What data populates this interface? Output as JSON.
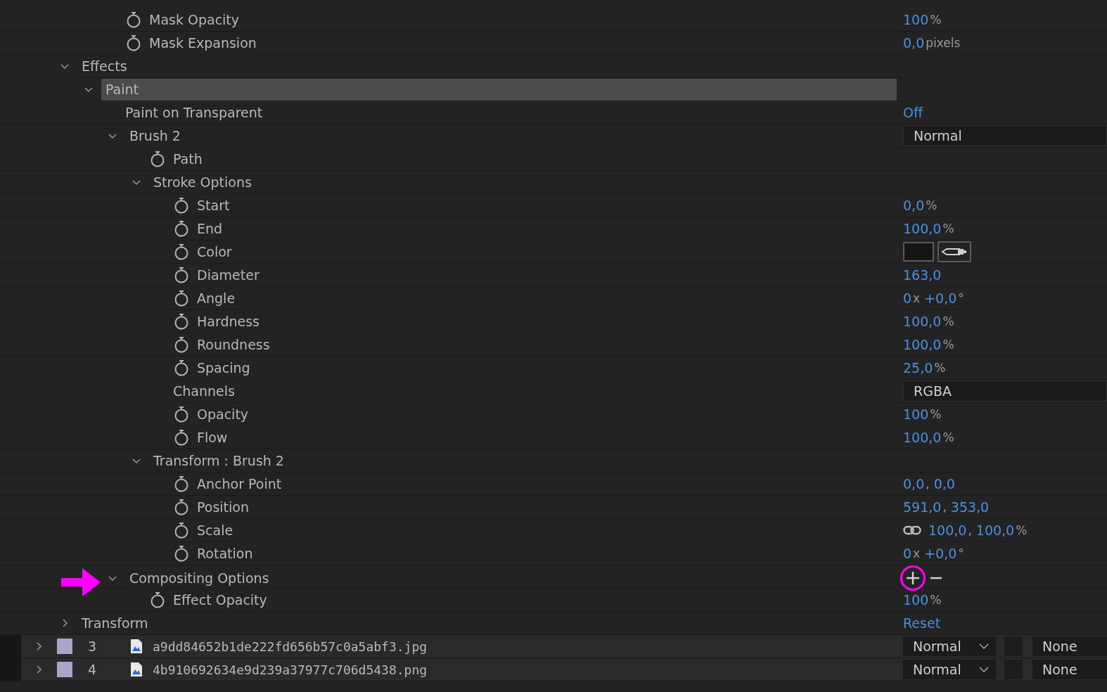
{
  "mask_properties": [
    {
      "label": "Mask Opacity",
      "kind": "property",
      "selected": false,
      "value": {
        "kind": "number",
        "parts": [
          {
            "text": "100",
            "kind": "num"
          },
          {
            "text": "%",
            "kind": "unit"
          }
        ]
      }
    },
    {
      "label": "Mask Expansion",
      "kind": "property",
      "selected": false,
      "value": {
        "kind": "number",
        "parts": [
          {
            "text": "0,0",
            "kind": "num"
          },
          {
            "text": "pixels",
            "kind": "unit"
          }
        ]
      }
    }
  ],
  "effects": [
    {
      "label": "Effects",
      "kind": "group",
      "expanded": true,
      "selected": false,
      "children": [
        {
          "label": "Paint",
          "kind": "group",
          "expanded": true,
          "selected": true,
          "children": [
            {
              "label": "Paint on Transparent",
              "kind": "plain",
              "selected": false,
              "value": {
                "kind": "number",
                "parts": [
                  {
                    "text": "Off",
                    "kind": "num"
                  }
                ]
              }
            },
            {
              "label": "Brush 2",
              "kind": "group",
              "expanded": true,
              "selected": false,
              "value": {
                "kind": "dropdown",
                "text": "Normal"
              },
              "children": [
                {
                  "label": "Path",
                  "kind": "property",
                  "selected": false
                },
                {
                  "label": "Stroke Options",
                  "kind": "group",
                  "expanded": true,
                  "selected": false,
                  "children": [
                    {
                      "label": "Start",
                      "kind": "property",
                      "selected": false,
                      "value": {
                        "kind": "number",
                        "parts": [
                          {
                            "text": "0,0",
                            "kind": "num"
                          },
                          {
                            "text": "%",
                            "kind": "unit"
                          }
                        ]
                      }
                    },
                    {
                      "label": "End",
                      "kind": "property",
                      "selected": false,
                      "value": {
                        "kind": "number",
                        "parts": [
                          {
                            "text": "100,0",
                            "kind": "num"
                          },
                          {
                            "text": "%",
                            "kind": "unit"
                          }
                        ]
                      }
                    },
                    {
                      "label": "Color",
                      "kind": "property",
                      "selected": false,
                      "value": {
                        "kind": "color",
                        "color": "#151515"
                      }
                    },
                    {
                      "label": "Diameter",
                      "kind": "property",
                      "selected": false,
                      "value": {
                        "kind": "number",
                        "parts": [
                          {
                            "text": "163,0",
                            "kind": "num"
                          }
                        ]
                      }
                    },
                    {
                      "label": "Angle",
                      "kind": "property",
                      "selected": false,
                      "value": {
                        "kind": "number",
                        "parts": [
                          {
                            "text": "0",
                            "kind": "num"
                          },
                          {
                            "text": "x",
                            "kind": "unit"
                          },
                          {
                            "text": "+0,0",
                            "kind": "num"
                          },
                          {
                            "text": "°",
                            "kind": "unit"
                          }
                        ]
                      }
                    },
                    {
                      "label": "Hardness",
                      "kind": "property",
                      "selected": false,
                      "value": {
                        "kind": "number",
                        "parts": [
                          {
                            "text": "100,0",
                            "kind": "num"
                          },
                          {
                            "text": "%",
                            "kind": "unit"
                          }
                        ]
                      }
                    },
                    {
                      "label": "Roundness",
                      "kind": "property",
                      "selected": false,
                      "value": {
                        "kind": "number",
                        "parts": [
                          {
                            "text": "100,0",
                            "kind": "num"
                          },
                          {
                            "text": "%",
                            "kind": "unit"
                          }
                        ]
                      }
                    },
                    {
                      "label": "Spacing",
                      "kind": "property",
                      "selected": false,
                      "value": {
                        "kind": "number",
                        "parts": [
                          {
                            "text": "25,0",
                            "kind": "num"
                          },
                          {
                            "text": "%",
                            "kind": "unit"
                          }
                        ]
                      }
                    },
                    {
                      "label": "Channels",
                      "kind": "plain",
                      "selected": false,
                      "value": {
                        "kind": "dropdown",
                        "text": "RGBA"
                      }
                    },
                    {
                      "label": "Opacity",
                      "kind": "property",
                      "selected": false,
                      "value": {
                        "kind": "number",
                        "parts": [
                          {
                            "text": "100",
                            "kind": "num"
                          },
                          {
                            "text": "%",
                            "kind": "unit"
                          }
                        ]
                      }
                    },
                    {
                      "label": "Flow",
                      "kind": "property",
                      "selected": false,
                      "value": {
                        "kind": "number",
                        "parts": [
                          {
                            "text": "100,0",
                            "kind": "num"
                          },
                          {
                            "text": "%",
                            "kind": "unit"
                          }
                        ]
                      }
                    }
                  ]
                },
                {
                  "label": "Transform : Brush 2",
                  "kind": "group",
                  "expanded": true,
                  "selected": false,
                  "children": [
                    {
                      "label": "Anchor Point",
                      "kind": "property",
                      "selected": false,
                      "value": {
                        "kind": "number",
                        "parts": [
                          {
                            "text": "0,0",
                            "kind": "num"
                          },
                          {
                            "text": ",",
                            "kind": "unit"
                          },
                          {
                            "text": "0,0",
                            "kind": "num"
                          }
                        ]
                      }
                    },
                    {
                      "label": "Position",
                      "kind": "property",
                      "selected": false,
                      "value": {
                        "kind": "number",
                        "parts": [
                          {
                            "text": "591,0",
                            "kind": "num"
                          },
                          {
                            "text": ",",
                            "kind": "unit"
                          },
                          {
                            "text": "353,0",
                            "kind": "num"
                          }
                        ]
                      }
                    },
                    {
                      "label": "Scale",
                      "kind": "property",
                      "selected": false,
                      "value": {
                        "kind": "scale",
                        "parts": [
                          {
                            "text": "100,0",
                            "kind": "num"
                          },
                          {
                            "text": ",",
                            "kind": "unit"
                          },
                          {
                            "text": "100,0",
                            "kind": "num"
                          },
                          {
                            "text": "%",
                            "kind": "unit"
                          }
                        ]
                      }
                    },
                    {
                      "label": "Rotation",
                      "kind": "property",
                      "selected": false,
                      "value": {
                        "kind": "number",
                        "parts": [
                          {
                            "text": "0",
                            "kind": "num"
                          },
                          {
                            "text": "x",
                            "kind": "unit"
                          },
                          {
                            "text": "+0,0",
                            "kind": "num"
                          },
                          {
                            "text": "°",
                            "kind": "unit"
                          }
                        ]
                      }
                    }
                  ]
                }
              ]
            },
            {
              "label": "Compositing Options",
              "kind": "group",
              "expanded": true,
              "selected": false,
              "highlighted": true,
              "value": {
                "kind": "plus_minus",
                "circled": true
              },
              "children": [
                {
                  "label": "Effect Opacity",
                  "kind": "property",
                  "selected": false,
                  "value": {
                    "kind": "number",
                    "parts": [
                      {
                        "text": "100",
                        "kind": "num"
                      },
                      {
                        "text": "%",
                        "kind": "unit"
                      }
                    ]
                  }
                }
              ]
            }
          ]
        }
      ]
    },
    {
      "label": "Transform",
      "kind": "group",
      "expanded": false,
      "selected": false,
      "value": {
        "kind": "link",
        "text": "Reset"
      }
    }
  ],
  "layers": [
    {
      "number": "3",
      "name": "a9dd84652b1de222fd656b57c0a5abf3.jpg",
      "color": "#a9a4c9",
      "expanded": false,
      "mode": "Normal",
      "track_matte": "None"
    },
    {
      "number": "4",
      "name": "4b910692634e9d239a37977c706d5438.png",
      "color": "#a9a4c9",
      "expanded": false,
      "mode": "Normal",
      "track_matte": "None"
    }
  ]
}
